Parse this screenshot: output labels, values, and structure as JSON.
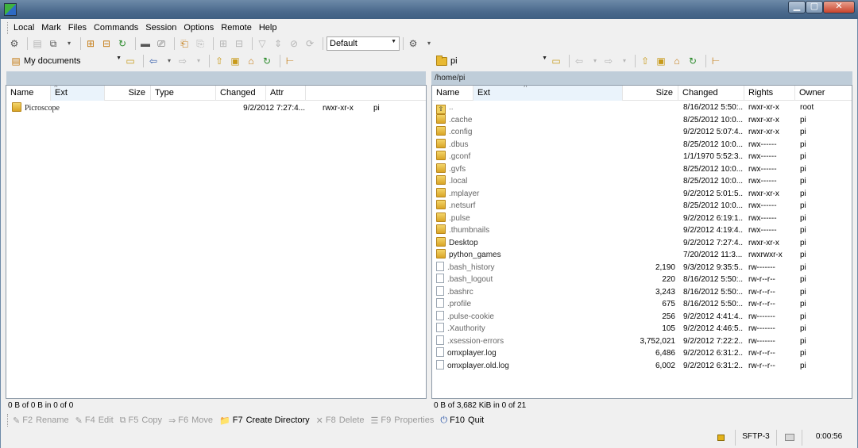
{
  "menu": [
    "Local",
    "Mark",
    "Files",
    "Commands",
    "Session",
    "Options",
    "Remote",
    "Help"
  ],
  "toolbar": {
    "transfer_settings": "Default"
  },
  "left_panel": {
    "location": "My documents",
    "columns": {
      "name": "Name",
      "ext": "Ext",
      "size": "Size",
      "type": "Type",
      "changed": "Changed",
      "attr": "Attr"
    },
    "files": [
      {
        "name": "Picroscope",
        "changed": "9/2/2012 7:27:4...",
        "attr": "rwxr-xr-x",
        "owner": "pi"
      }
    ],
    "status": "0 B of 0 B in 0 of 0"
  },
  "right_panel": {
    "location": "pi",
    "path": "/home/pi",
    "columns": {
      "name": "Name",
      "ext": "Ext",
      "size": "Size",
      "changed": "Changed",
      "rights": "Rights",
      "owner": "Owner"
    },
    "files": [
      {
        "name": "..",
        "kind": "up",
        "size": "",
        "changed": "8/16/2012 5:50:...",
        "rights": "rwxr-xr-x",
        "owner": "root"
      },
      {
        "name": ".cache",
        "kind": "folder",
        "size": "",
        "changed": "8/25/2012 10:0...",
        "rights": "rwxr-xr-x",
        "owner": "pi"
      },
      {
        "name": ".config",
        "kind": "folder",
        "size": "",
        "changed": "9/2/2012 5:07:4...",
        "rights": "rwxr-xr-x",
        "owner": "pi"
      },
      {
        "name": ".dbus",
        "kind": "folder",
        "size": "",
        "changed": "8/25/2012 10:0...",
        "rights": "rwx------",
        "owner": "pi"
      },
      {
        "name": ".gconf",
        "kind": "folder",
        "size": "",
        "changed": "1/1/1970 5:52:3...",
        "rights": "rwx------",
        "owner": "pi"
      },
      {
        "name": ".gvfs",
        "kind": "folder",
        "size": "",
        "changed": "8/25/2012 10:0...",
        "rights": "rwx------",
        "owner": "pi"
      },
      {
        "name": ".local",
        "kind": "folder",
        "size": "",
        "changed": "8/25/2012 10:0...",
        "rights": "rwx------",
        "owner": "pi"
      },
      {
        "name": ".mplayer",
        "kind": "folder",
        "size": "",
        "changed": "9/2/2012 5:01:5...",
        "rights": "rwxr-xr-x",
        "owner": "pi"
      },
      {
        "name": ".netsurf",
        "kind": "folder",
        "size": "",
        "changed": "8/25/2012 10:0...",
        "rights": "rwx------",
        "owner": "pi"
      },
      {
        "name": ".pulse",
        "kind": "folder",
        "size": "",
        "changed": "9/2/2012 6:19:1...",
        "rights": "rwx------",
        "owner": "pi"
      },
      {
        "name": ".thumbnails",
        "kind": "folder",
        "size": "",
        "changed": "9/2/2012 4:19:4...",
        "rights": "rwx------",
        "owner": "pi"
      },
      {
        "name": "Desktop",
        "kind": "folder",
        "size": "",
        "changed": "9/2/2012 7:27:4...",
        "rights": "rwxr-xr-x",
        "owner": "pi"
      },
      {
        "name": "python_games",
        "kind": "folder",
        "size": "",
        "changed": "7/20/2012 11:3...",
        "rights": "rwxrwxr-x",
        "owner": "pi"
      },
      {
        "name": ".bash_history",
        "kind": "file",
        "size": "2,190",
        "changed": "9/3/2012 9:35:5...",
        "rights": "rw-------",
        "owner": "pi"
      },
      {
        "name": ".bash_logout",
        "kind": "file",
        "size": "220",
        "changed": "8/16/2012 5:50:...",
        "rights": "rw-r--r--",
        "owner": "pi"
      },
      {
        "name": ".bashrc",
        "kind": "file",
        "size": "3,243",
        "changed": "8/16/2012 5:50:...",
        "rights": "rw-r--r--",
        "owner": "pi"
      },
      {
        "name": ".profile",
        "kind": "file",
        "size": "675",
        "changed": "8/16/2012 5:50:...",
        "rights": "rw-r--r--",
        "owner": "pi"
      },
      {
        "name": ".pulse-cookie",
        "kind": "file",
        "size": "256",
        "changed": "9/2/2012 4:41:4...",
        "rights": "rw-------",
        "owner": "pi"
      },
      {
        "name": ".Xauthority",
        "kind": "file",
        "size": "105",
        "changed": "9/2/2012 4:46:5...",
        "rights": "rw-------",
        "owner": "pi"
      },
      {
        "name": ".xsession-errors",
        "kind": "file",
        "size": "3,752,021",
        "changed": "9/2/2012 7:22:2...",
        "rights": "rw-------",
        "owner": "pi"
      },
      {
        "name": "omxplayer.log",
        "kind": "file",
        "size": "6,486",
        "changed": "9/2/2012 6:31:2...",
        "rights": "rw-r--r--",
        "owner": "pi"
      },
      {
        "name": "omxplayer.old.log",
        "kind": "file",
        "size": "6,002",
        "changed": "9/2/2012 6:31:2...",
        "rights": "rw-r--r--",
        "owner": "pi"
      }
    ],
    "status": "0 B of 3,682 KiB in 0 of 21"
  },
  "keybar": [
    {
      "key": "F2",
      "label": "Rename",
      "enabled": false
    },
    {
      "key": "F4",
      "label": "Edit",
      "enabled": false
    },
    {
      "key": "F5",
      "label": "Copy",
      "enabled": false
    },
    {
      "key": "F6",
      "label": "Move",
      "enabled": false
    },
    {
      "key": "F7",
      "label": "Create Directory",
      "enabled": true
    },
    {
      "key": "F8",
      "label": "Delete",
      "enabled": false
    },
    {
      "key": "F9",
      "label": "Properties",
      "enabled": false
    },
    {
      "key": "F10",
      "label": "Quit",
      "enabled": true
    }
  ],
  "statusbar": {
    "protocol": "SFTP-3",
    "elapsed": "0:00:56"
  }
}
